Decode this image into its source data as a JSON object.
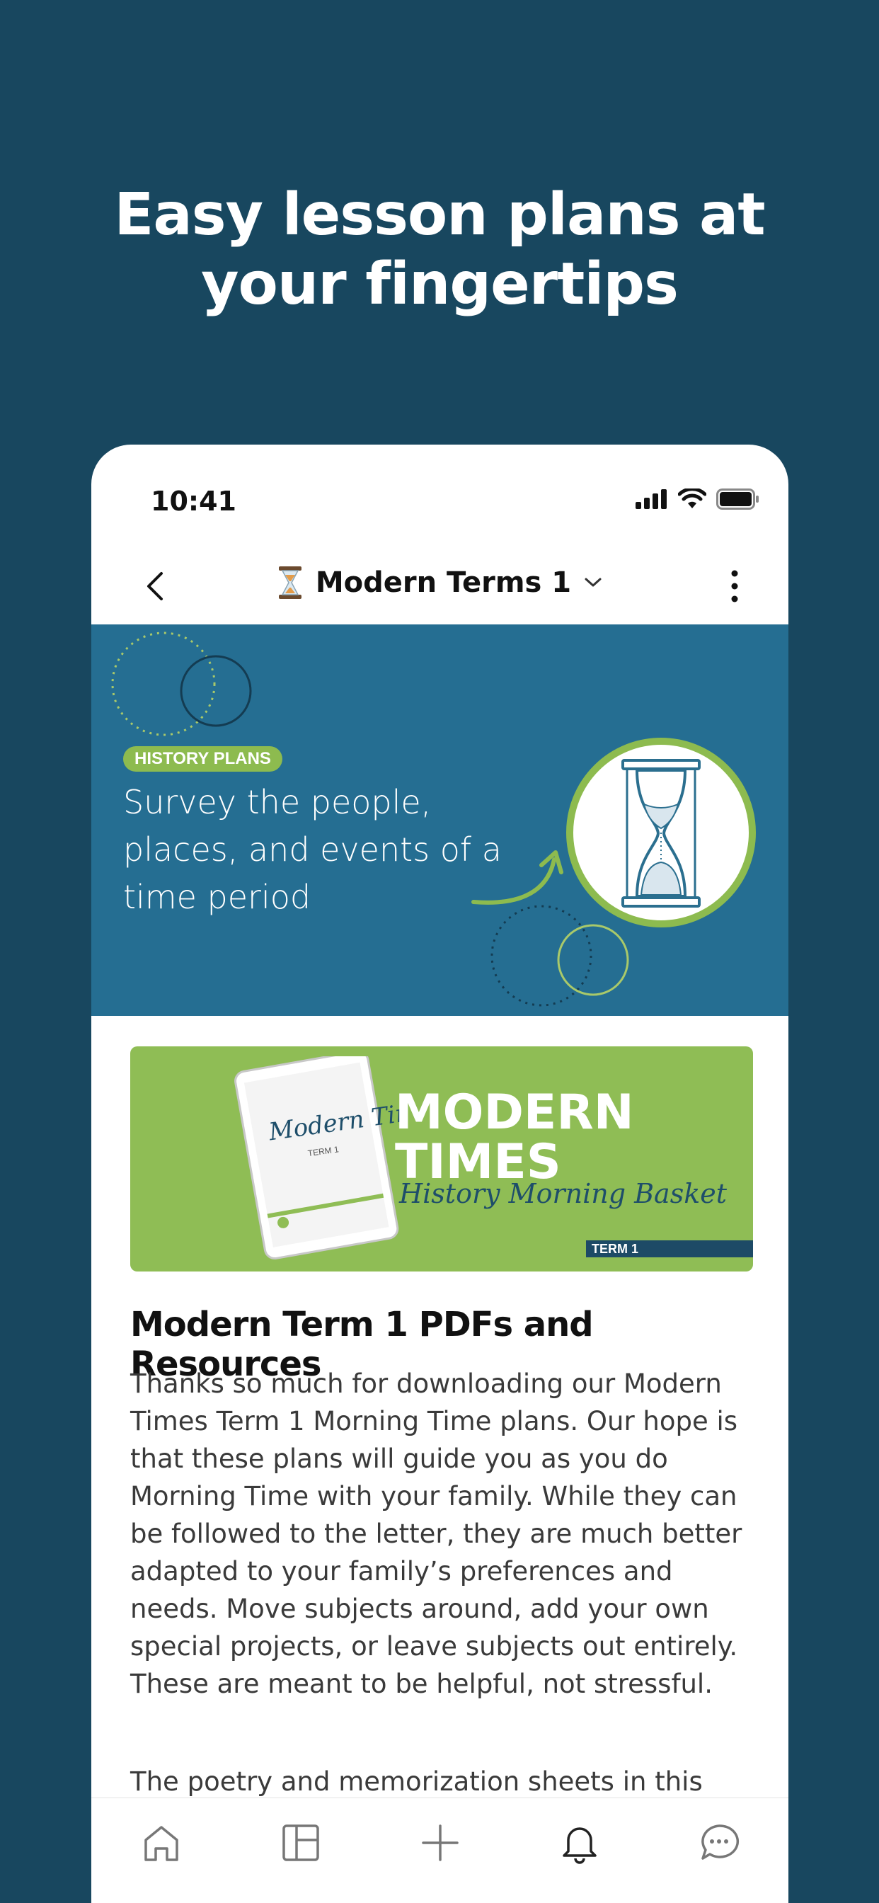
{
  "promo": {
    "headline_line1": "Easy lesson plans at",
    "headline_line2": "your fingertips"
  },
  "status_bar": {
    "time": "10:41",
    "icons": [
      "cellular-signal-icon",
      "wifi-icon",
      "battery-icon"
    ]
  },
  "nav": {
    "back_icon": "chevron-left-icon",
    "title_icon": "hourglass-emoji-icon",
    "title": "Modern Terms 1",
    "dropdown_icon": "chevron-down-icon",
    "more_icon": "more-vertical-icon"
  },
  "banner": {
    "tag": "HISTORY PLANS",
    "text": "Survey the people, places, and events of a time period",
    "icon": "hourglass-icon",
    "colors": {
      "background": "#256e92",
      "accent": "#8dbb4f"
    }
  },
  "course_card": {
    "title_line1": "MODERN",
    "title_line2": "TIMES",
    "script_subtitle": "History Morning Basket",
    "term_label": "TERM 1",
    "tablet_title": "Modern Times",
    "tablet_term": "TERM 1",
    "background": "#8fbd55"
  },
  "article": {
    "title": "Modern Term 1 PDFs and Resources",
    "paragraph1": "Thanks so much for downloading our Modern Times Term 1 Morning Time plans. Our hope is that these plans will guide you as you do Morning Time with your family. While they can be followed to the letter, they are much better adapted to your family’s preferences and needs. Move subjects around, add your own special projects, or leave subjects out entirely. These are meant to be helpful, not stressful.",
    "paragraph2": "The poetry and memorization sheets in this"
  },
  "tab_bar": {
    "items": [
      {
        "icon": "home-icon"
      },
      {
        "icon": "layout-icon"
      },
      {
        "icon": "plus-icon"
      },
      {
        "icon": "bell-icon"
      },
      {
        "icon": "chat-bubble-icon"
      }
    ]
  }
}
